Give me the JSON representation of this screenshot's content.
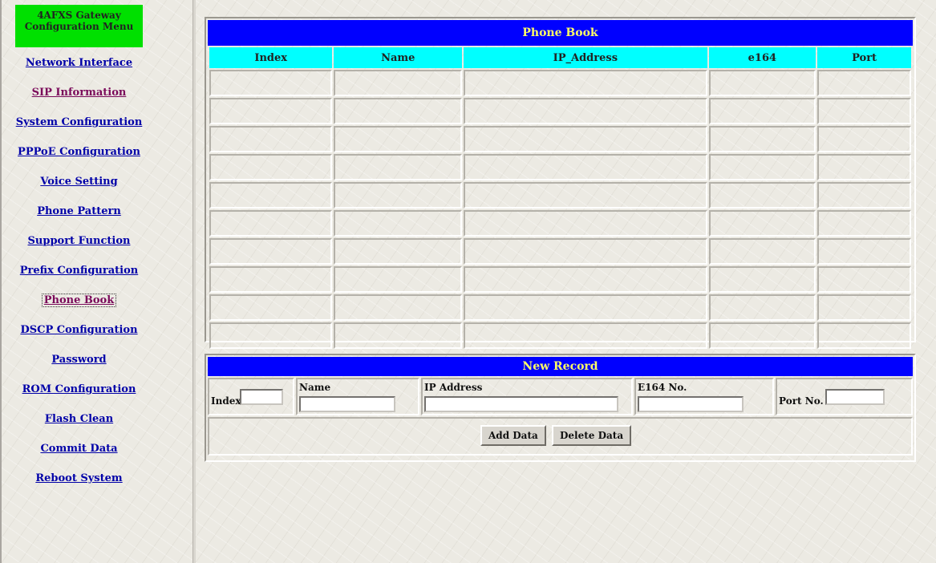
{
  "sidebar": {
    "title_line1": "4AFXS Gateway",
    "title_line2": "Configuration Menu",
    "items": [
      {
        "label": "Network Interface"
      },
      {
        "label": "SIP Information"
      },
      {
        "label": "System Configuration"
      },
      {
        "label": "PPPoE Configuration"
      },
      {
        "label": "Voice Setting"
      },
      {
        "label": "Phone Pattern"
      },
      {
        "label": "Support Function"
      },
      {
        "label": "Prefix Configuration"
      },
      {
        "label": "Phone Book"
      },
      {
        "label": "DSCP Configuration"
      },
      {
        "label": "Password"
      },
      {
        "label": "ROM Configuration"
      },
      {
        "label": "Flash Clean"
      },
      {
        "label": "Commit Data"
      },
      {
        "label": "Reboot System"
      }
    ]
  },
  "phonebook": {
    "title": "Phone Book",
    "columns": [
      "Index",
      "Name",
      "IP_Address",
      "e164",
      "Port"
    ],
    "rows": [
      [
        "",
        "",
        "",
        "",
        ""
      ],
      [
        "",
        "",
        "",
        "",
        ""
      ],
      [
        "",
        "",
        "",
        "",
        ""
      ],
      [
        "",
        "",
        "",
        "",
        ""
      ],
      [
        "",
        "",
        "",
        "",
        ""
      ],
      [
        "",
        "",
        "",
        "",
        ""
      ],
      [
        "",
        "",
        "",
        "",
        ""
      ],
      [
        "",
        "",
        "",
        "",
        ""
      ],
      [
        "",
        "",
        "",
        "",
        ""
      ],
      [
        "",
        "",
        "",
        "",
        ""
      ]
    ]
  },
  "new_record": {
    "title": "New Record",
    "index_label": "Index",
    "index_value": "",
    "name_label": "Name",
    "name_value": "",
    "ip_label": "IP Address",
    "ip_value": "",
    "e164_label": "E164 No.",
    "e164_value": "",
    "port_label": "Port No.",
    "port_value": "",
    "add_button": "Add Data",
    "delete_button": "Delete Data"
  }
}
